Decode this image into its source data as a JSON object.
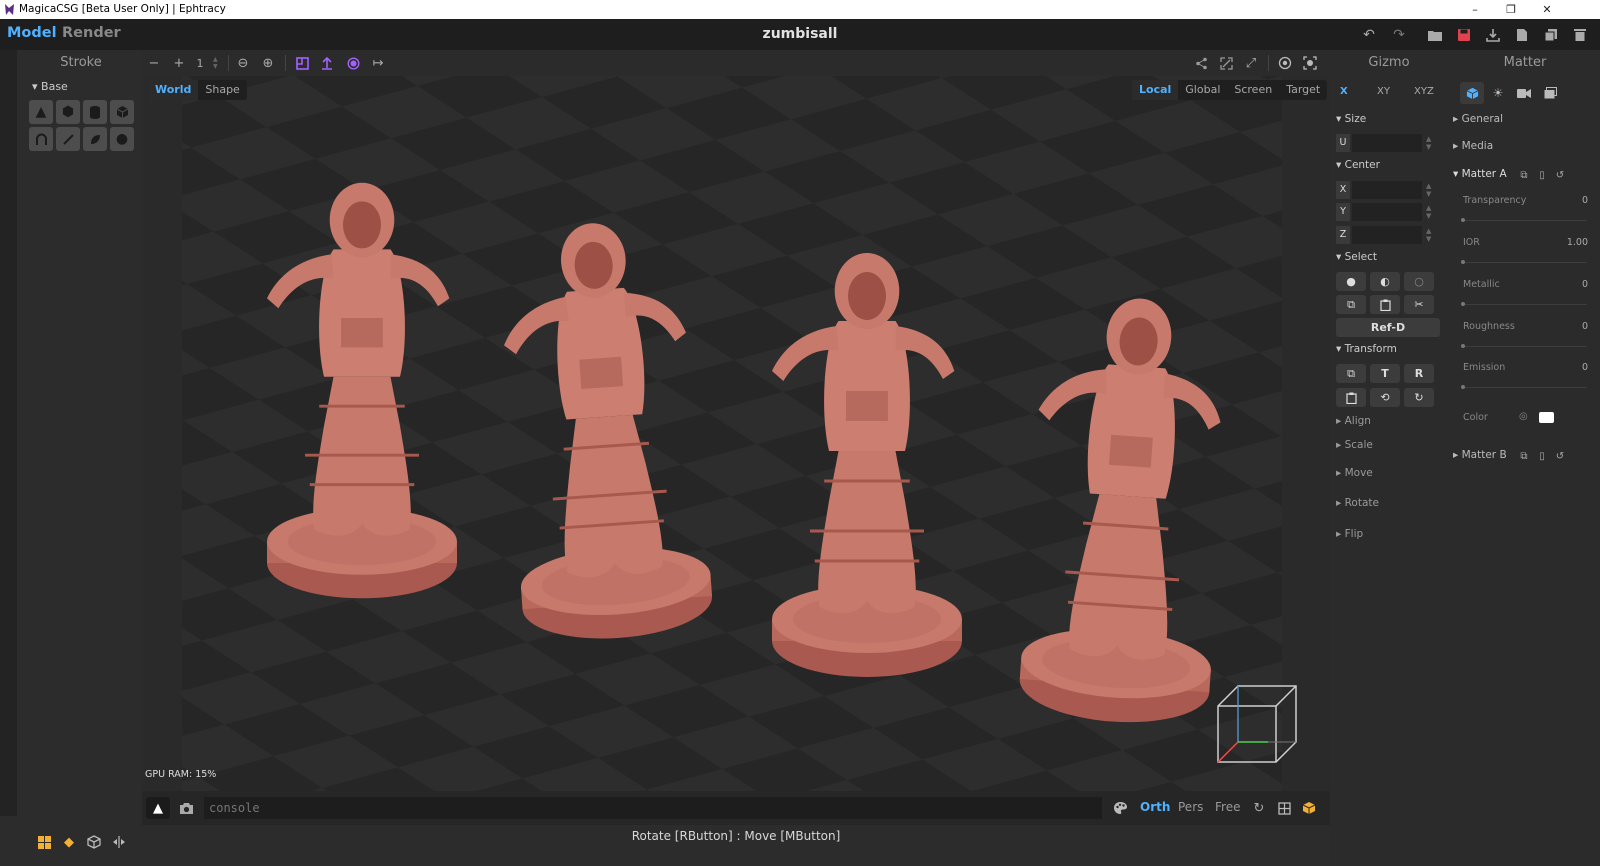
{
  "window": {
    "title": "MagicaCSG [Beta User Only] | Ephtracy",
    "controls": {
      "minimize": "–",
      "restore": "❐",
      "close": "✕"
    }
  },
  "header": {
    "tabs": [
      {
        "label": "Model",
        "active": true
      },
      {
        "label": "Render",
        "active": false
      }
    ],
    "document_title": "zumbisall",
    "icons": [
      "undo-icon",
      "redo-icon",
      "open-folder-icon",
      "save-icon",
      "export-icon",
      "new-file-icon",
      "copy-file-icon",
      "delete-icon"
    ]
  },
  "left_panel": {
    "title": "Stroke",
    "section": "Base",
    "shapes_row1": [
      "cone-icon",
      "sphere-icon",
      "cylinder-icon",
      "box-icon"
    ],
    "shapes_row2": [
      "arc-icon",
      "line-icon",
      "leaf-icon",
      "ball-icon"
    ],
    "bottom_icons": [
      "grid-icon",
      "diamond-icon",
      "cube-outline-icon",
      "mirror-icon"
    ]
  },
  "toolbar": {
    "minus": "−",
    "plus": "+",
    "count_value": "1",
    "icons_left": [
      "zoom-out-icon",
      "zoom-in-icon",
      "frame-icon",
      "upload-arrow-icon",
      "target-circle-icon",
      "arrow-right-icon"
    ],
    "icons_right": [
      "share-icon",
      "expand-icon",
      "fullscreen-icon",
      "focus-icon",
      "screenshot-icon"
    ]
  },
  "viewport": {
    "space_tabs": [
      {
        "label": "World",
        "active": true
      },
      {
        "label": "Shape",
        "active": false
      }
    ],
    "coord_tabs": [
      {
        "label": "Local",
        "active": true
      },
      {
        "label": "Global",
        "active": false
      },
      {
        "label": "Screen",
        "active": false
      },
      {
        "label": "Target",
        "active": false
      }
    ],
    "gpu_ram": "GPU RAM:  15%",
    "model_color": "#c7796b"
  },
  "console": {
    "placeholder": "console",
    "view_modes": [
      {
        "label": "Orth",
        "active": true
      },
      {
        "label": "Pers",
        "active": false
      },
      {
        "label": "Free",
        "active": false
      }
    ],
    "status": "Rotate [RButton] : Move [MButton]"
  },
  "gizmo": {
    "title": "Gizmo",
    "axis_tabs": [
      {
        "label": "X",
        "active": true
      },
      {
        "label": "XY",
        "active": false
      },
      {
        "label": "XYZ",
        "active": false
      }
    ],
    "size_label": "Size",
    "size_axis": "U",
    "center_label": "Center",
    "center_axes": [
      "X",
      "Y",
      "Z"
    ],
    "select_label": "Select",
    "refd_label": "Ref-D",
    "transform_label": "Transform",
    "transform_t": "T",
    "transform_r": "R",
    "collapsed_sections": [
      "Align",
      "Scale",
      "Move",
      "Rotate",
      "Flip"
    ]
  },
  "matter": {
    "title": "Matter",
    "tab_icons": [
      "material-cube-icon",
      "light-icon",
      "camera-icon",
      "image-icon"
    ],
    "general_label": "General",
    "media_label": "Media",
    "matter_a_label": "Matter A",
    "matter_b_label": "Matter B",
    "properties": [
      {
        "label": "Transparency",
        "value": "0"
      },
      {
        "label": "IOR",
        "value": "1.00"
      },
      {
        "label": "Metallic",
        "value": "0"
      },
      {
        "label": "Roughness",
        "value": "0"
      },
      {
        "label": "Emission",
        "value": "0"
      }
    ],
    "color_label": "Color",
    "color_value": "#ffffff",
    "accent": "#4fb1ff"
  }
}
